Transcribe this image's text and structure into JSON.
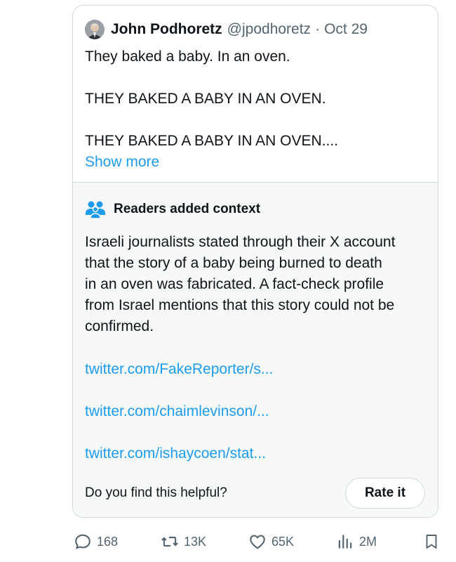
{
  "tweet": {
    "author_name": "John Podhoretz",
    "handle": "@jpodhoretz",
    "separator": "·",
    "date": "Oct 29",
    "lines": [
      "They baked a baby. In an oven.",
      "THEY BAKED A BABY IN AN OVEN.",
      "THEY BAKED A BABY IN AN OVEN...."
    ],
    "show_more": "Show more"
  },
  "context": {
    "title": "Readers added context",
    "body_lines": [
      "Israeli journalists stated through their X account",
      "that the story of a baby being burned to death",
      "in an oven was fabricated.  A fact-check profile",
      "from Israel mentions that this story could not be",
      "confirmed."
    ],
    "links": [
      "twitter.com/FakeReporter/s...",
      "twitter.com/chaimlevinson/...",
      "twitter.com/ishaycoen/stat..."
    ],
    "helpful_question": "Do you find this helpful?",
    "rate_label": "Rate it"
  },
  "actions": {
    "replies": "168",
    "reposts": "13K",
    "likes": "65K",
    "views": "2M",
    "icons": [
      "reply-icon",
      "repost-icon",
      "like-icon",
      "views-icon",
      "bookmark-icon"
    ]
  },
  "colors": {
    "text": "#0f1419",
    "secondary": "#536471",
    "link": "#1d9bf0",
    "border": "#cfd9de",
    "context_bg": "#f7f9f9"
  }
}
